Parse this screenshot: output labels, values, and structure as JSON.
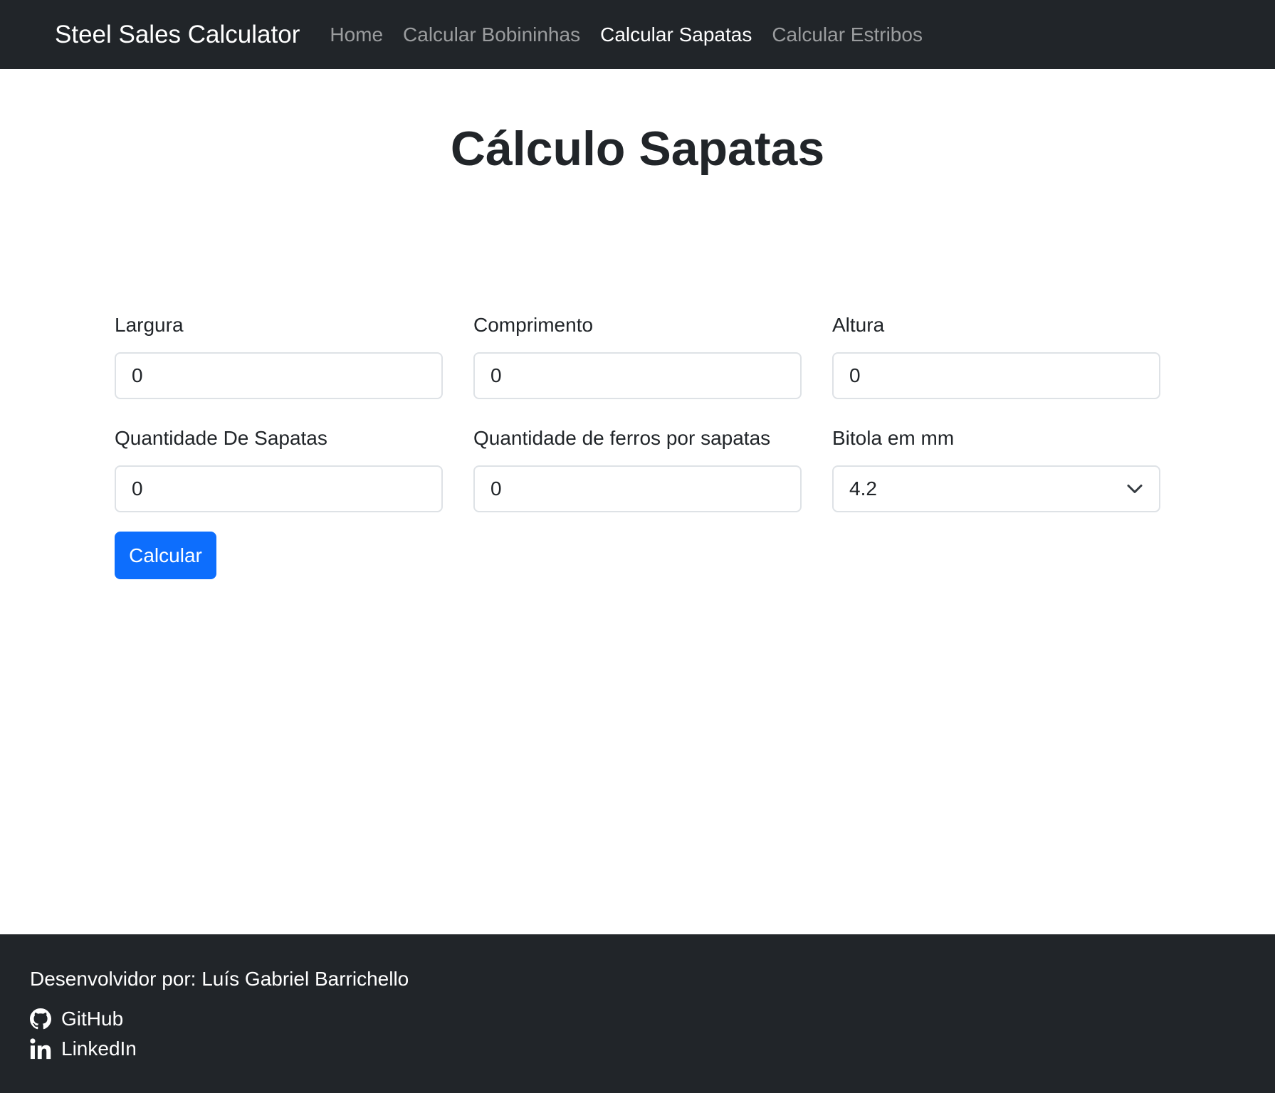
{
  "navbar": {
    "brand": "Steel Sales Calculator",
    "links": [
      {
        "label": "Home",
        "active": false
      },
      {
        "label": "Calcular Bobininhas",
        "active": false
      },
      {
        "label": "Calcular Sapatas",
        "active": true
      },
      {
        "label": "Calcular Estribos",
        "active": false
      }
    ]
  },
  "main": {
    "title": "Cálculo Sapatas",
    "fields": {
      "largura": {
        "label": "Largura",
        "value": "0"
      },
      "comprimento": {
        "label": "Comprimento",
        "value": "0"
      },
      "altura": {
        "label": "Altura",
        "value": "0"
      },
      "quantidade_sapatas": {
        "label": "Quantidade De Sapatas",
        "value": "0"
      },
      "quantidade_ferros": {
        "label": "Quantidade de ferros por sapatas",
        "value": "0"
      },
      "bitola": {
        "label": "Bitola em mm",
        "selected": "4.2"
      }
    },
    "submit_label": "Calcular"
  },
  "footer": {
    "credit": "Desenvolvidor por: Luís Gabriel Barrichello",
    "links": [
      {
        "label": "GitHub",
        "icon": "github-icon"
      },
      {
        "label": "LinkedIn",
        "icon": "linkedin-icon"
      }
    ]
  },
  "colors": {
    "navbar_bg": "#212529",
    "primary": "#0d6efd",
    "footer_bg": "#212529"
  }
}
